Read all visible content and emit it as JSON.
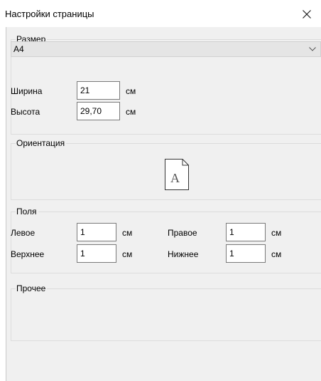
{
  "window": {
    "title": "Настройки страницы",
    "close_icon": "close-icon"
  },
  "size": {
    "legend": "Размер",
    "paper": {
      "selected": "A4",
      "icon": "chevron-down-icon"
    },
    "width": {
      "label": "Ширина",
      "value": "21",
      "unit": "см"
    },
    "height": {
      "label": "Высота",
      "value": "29,70",
      "unit": "см"
    }
  },
  "orientation": {
    "legend": "Ориентация",
    "icon": "portrait-page-icon",
    "icon_letter": "A"
  },
  "margins": {
    "legend": "Поля",
    "left": {
      "label": "Левое",
      "value": "1",
      "unit": "см"
    },
    "right": {
      "label": "Правое",
      "value": "1",
      "unit": "см"
    },
    "top": {
      "label": "Верхнее",
      "value": "1",
      "unit": "см"
    },
    "bottom": {
      "label": "Нижнее",
      "value": "1",
      "unit": "см"
    }
  },
  "other": {
    "legend": "Прочее"
  }
}
